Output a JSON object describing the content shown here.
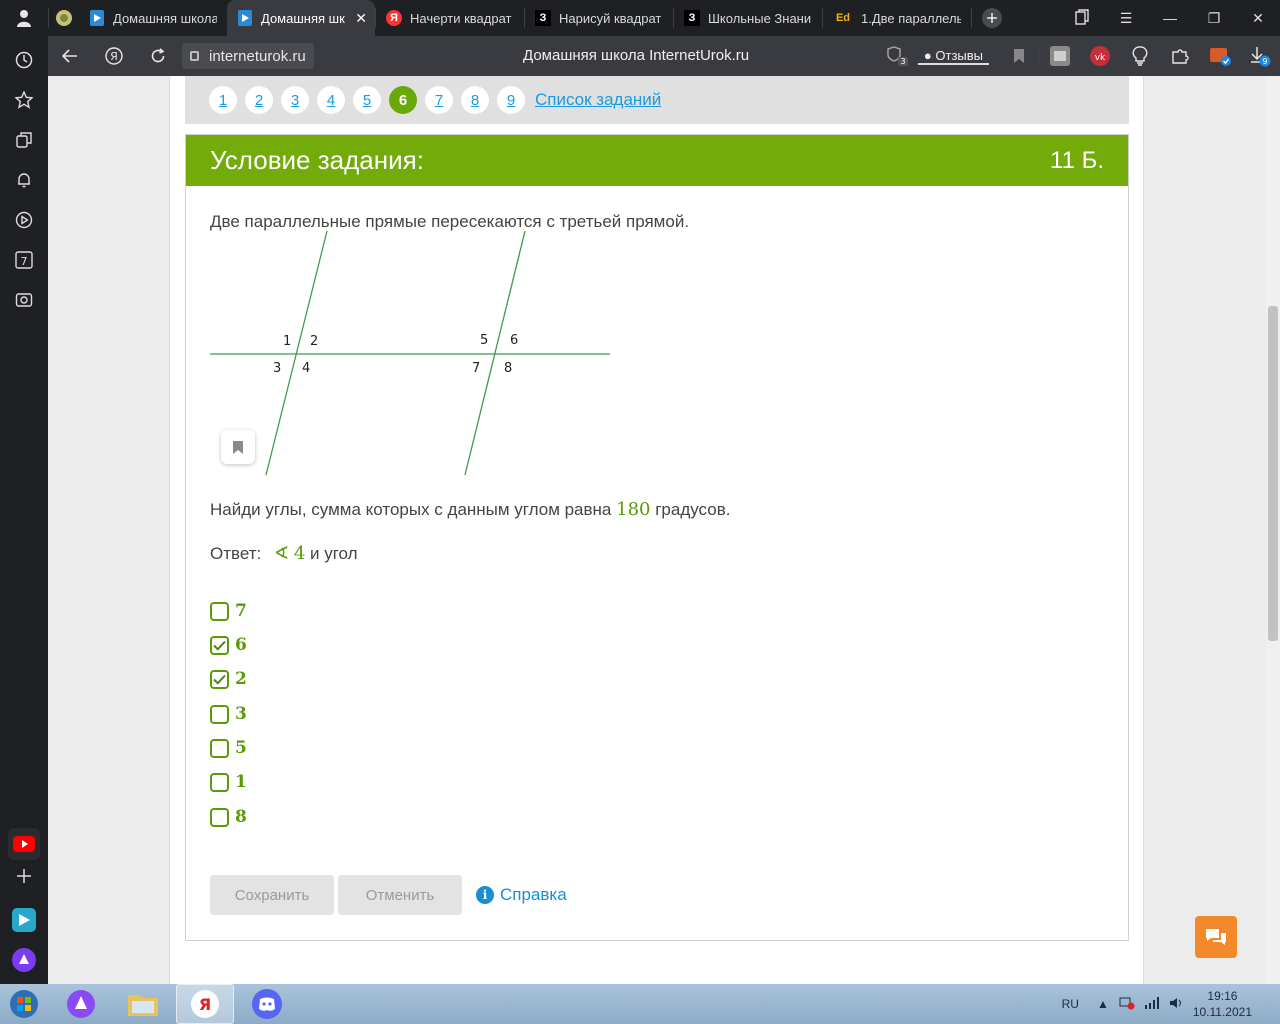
{
  "browser": {
    "tabs": [
      {
        "label": "Домашняя школа",
        "favicon": "interneturok-favicon"
      },
      {
        "label": "Домашняя шк",
        "favicon": "interneturok-favicon",
        "active": true
      },
      {
        "label": "Начерти квадрат",
        "favicon": "yandex-favicon"
      },
      {
        "label": "Нарисуй квадрат",
        "favicon": "znanija-favicon"
      },
      {
        "label": "Школьные Знани",
        "favicon": "znanija-favicon"
      },
      {
        "label": "1.Две параллелы",
        "favicon": "edu-favicon"
      }
    ],
    "favicon_text": {
      "yandex": "Я",
      "znanija": "З",
      "edu": "Ed"
    },
    "url": "interneturok.ru",
    "page_title": "Домашняя школа InternetUrok.ru",
    "reviews_label": "Отзывы",
    "shield_badge": "3",
    "downloads_badge": "9",
    "sidebar_calendar_day": "7"
  },
  "task_nav": {
    "numbers": [
      "1",
      "2",
      "3",
      "4",
      "5",
      "6",
      "7",
      "8",
      "9"
    ],
    "current": "6",
    "list_link": "Список заданий"
  },
  "task": {
    "header_title": "Условие задания:",
    "points": "11 Б.",
    "statement": "Две параллельные прямые пересекаются с третьей прямой.",
    "question_before": "Найди углы, сумма которых с данным углом равна",
    "question_number": "180",
    "question_after": "градусов.",
    "answer_label": "Ответ:",
    "angle_symbol": "∢",
    "angle_number": "4",
    "answer_suffix": "и угол",
    "diagram_labels": [
      "1",
      "2",
      "3",
      "4",
      "5",
      "6",
      "7",
      "8"
    ],
    "options": [
      {
        "label": "7",
        "checked": false
      },
      {
        "label": "6",
        "checked": true
      },
      {
        "label": "2",
        "checked": true
      },
      {
        "label": "3",
        "checked": false
      },
      {
        "label": "5",
        "checked": false
      },
      {
        "label": "1",
        "checked": false
      },
      {
        "label": "8",
        "checked": false
      }
    ],
    "save_label": "Сохранить",
    "cancel_label": "Отменить",
    "help_label": "Справка",
    "help_icon_text": "i"
  },
  "colors": {
    "accent_green": "#72ab0a",
    "link_blue": "#1a9be0",
    "chat_orange": "#f28a2c"
  },
  "taskbar": {
    "lang": "RU",
    "time": "19:16",
    "date": "10.11.2021"
  }
}
